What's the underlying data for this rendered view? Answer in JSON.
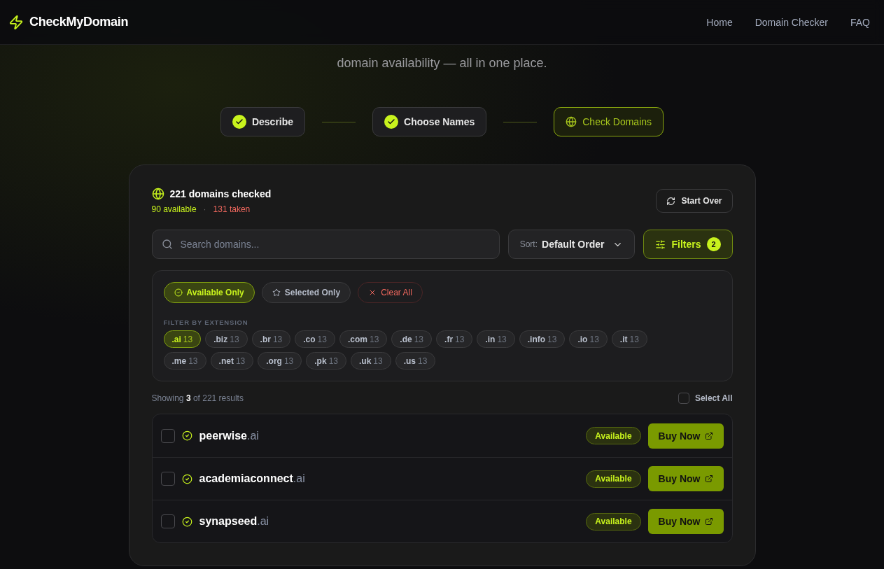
{
  "brand": {
    "name": "CheckMyDomain"
  },
  "nav": [
    {
      "label": "Home"
    },
    {
      "label": "Domain Checker"
    },
    {
      "label": "FAQ"
    }
  ],
  "hero": {
    "subtitle": "domain availability — all in one place."
  },
  "steps": [
    {
      "label": "Describe",
      "completed": true
    },
    {
      "label": "Choose Names",
      "completed": true
    },
    {
      "label": "Check Domains",
      "completed": false
    }
  ],
  "summary": {
    "title": "221 domains checked",
    "available": "90 available",
    "separator": "·",
    "taken": "131 taken"
  },
  "start_over": {
    "label": "Start Over"
  },
  "search": {
    "placeholder": "Search domains..."
  },
  "sort": {
    "label": "Sort:",
    "value": "Default Order"
  },
  "filters": {
    "label": "Filters",
    "count": "2",
    "open": true
  },
  "quick_filters": [
    {
      "label": "Available Only",
      "kind": "available",
      "selected": true
    },
    {
      "label": "Selected Only",
      "kind": "starred",
      "selected": false
    },
    {
      "label": "Clear All",
      "kind": "clear",
      "selected": false
    }
  ],
  "extensions_heading": "FILTER BY EXTENSION",
  "extensions": [
    {
      "name": ".ai",
      "count": "13",
      "selected": true
    },
    {
      "name": ".biz",
      "count": "13",
      "selected": false
    },
    {
      "name": ".br",
      "count": "13",
      "selected": false
    },
    {
      "name": ".co",
      "count": "13",
      "selected": false
    },
    {
      "name": ".com",
      "count": "13",
      "selected": false
    },
    {
      "name": ".de",
      "count": "13",
      "selected": false
    },
    {
      "name": ".fr",
      "count": "13",
      "selected": false
    },
    {
      "name": ".in",
      "count": "13",
      "selected": false
    },
    {
      "name": ".info",
      "count": "13",
      "selected": false
    },
    {
      "name": ".io",
      "count": "13",
      "selected": false
    },
    {
      "name": ".it",
      "count": "13",
      "selected": false
    },
    {
      "name": ".me",
      "count": "13",
      "selected": false
    },
    {
      "name": ".net",
      "count": "13",
      "selected": false
    },
    {
      "name": ".org",
      "count": "13",
      "selected": false
    },
    {
      "name": ".pk",
      "count": "13",
      "selected": false
    },
    {
      "name": ".uk",
      "count": "13",
      "selected": false
    },
    {
      "name": ".us",
      "count": "13",
      "selected": false
    }
  ],
  "results": {
    "showing": "Showing **3** of 221 results",
    "select_all": {
      "label": "Select All",
      "checked": false
    }
  },
  "domains": [
    {
      "name": "peerwise",
      "tld": ".ai",
      "checked": false,
      "status": "Available",
      "action": "Buy Now"
    },
    {
      "name": "academiaconnect",
      "tld": ".ai",
      "checked": false,
      "status": "Available",
      "action": "Buy Now"
    },
    {
      "name": "synapseed",
      "tld": ".ai",
      "checked": false,
      "status": "Available",
      "action": "Buy Now"
    }
  ]
}
